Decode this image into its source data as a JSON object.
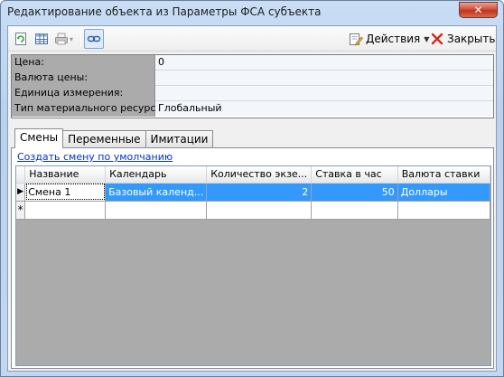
{
  "window": {
    "title": "Редактирование объекта из Параметры ФСА субъекта",
    "close_glyph": "✕"
  },
  "toolbar": {
    "actions_label": "Действия",
    "close_label": "Закрыть"
  },
  "properties": [
    {
      "label": "Цена:",
      "value": "0"
    },
    {
      "label": "Валюта цены:",
      "value": ""
    },
    {
      "label": "Единица измерения:",
      "value": ""
    },
    {
      "label": "Тип материального ресурса:",
      "value": "Глобальный"
    }
  ],
  "tabs": [
    {
      "label": "Смены",
      "active": true
    },
    {
      "label": "Переменные",
      "active": false
    },
    {
      "label": "Имитации",
      "active": false
    }
  ],
  "shifts": {
    "create_link": "Создать смену по умолчанию",
    "columns": [
      "Название",
      "Календарь",
      "Количество экзе...",
      "Ставка в час",
      "Валюта ставки"
    ],
    "rows": [
      {
        "name": "Смена 1",
        "calendar": "Базовый календ...",
        "count": "2",
        "rate": "50",
        "currency": "Доллары"
      }
    ],
    "current_row_marker": "▶",
    "new_row_marker": "*"
  }
}
